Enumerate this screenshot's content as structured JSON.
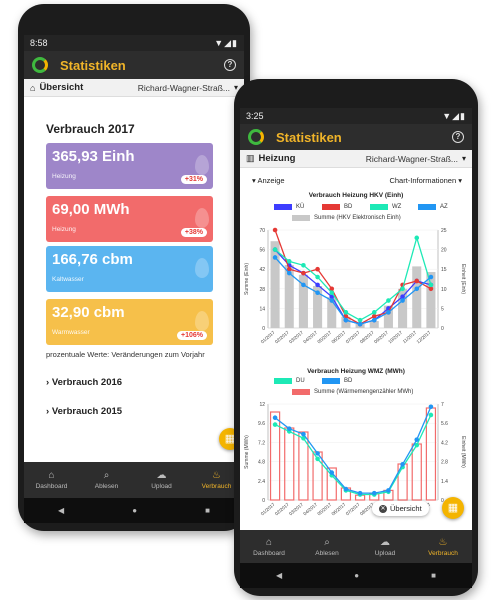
{
  "phone1": {
    "status": {
      "time": "8:58",
      "icons": "▼◢▮"
    },
    "app_title": "Statistiken",
    "sub": {
      "label": "Übersicht",
      "address": "Richard-Wagner-Straß..."
    },
    "heading": "Verbrauch 2017",
    "cards": [
      {
        "value": "365,93 Einh",
        "label": "Heizung",
        "badge": "+31%",
        "color": "#9e86c9"
      },
      {
        "value": "69,00 MWh",
        "label": "Heizung",
        "badge": "+38%",
        "color": "#f26b6b"
      },
      {
        "value": "166,76 cbm",
        "label": "Kaltwasser",
        "badge": "",
        "color": "#5bb5f0"
      },
      {
        "value": "32,90 cbm",
        "label": "Warmwasser",
        "badge": "+106%",
        "color": "#f6c04a"
      }
    ],
    "note": "prozentuale Werte: Veränderungen zum Vorjahr",
    "sections": [
      "Verbrauch 2016",
      "Verbrauch 2015"
    ],
    "nav": [
      {
        "label": "Dashboard",
        "icon": "⌂"
      },
      {
        "label": "Ablesen",
        "icon": "⌕"
      },
      {
        "label": "Upload",
        "icon": "☁"
      },
      {
        "label": "Verbrauch",
        "icon": "♨"
      }
    ]
  },
  "phone2": {
    "status": {
      "time": "3:25",
      "icons": "▼◢▮"
    },
    "app_title": "Statistiken",
    "sub": {
      "label": "Heizung",
      "address": "Richard-Wagner-Straß..."
    },
    "controls": {
      "left": "Anzeige",
      "right": "Chart-Informationen"
    },
    "chart1": {
      "title": "Verbrauch Heizung HKV (Einh)",
      "legend": [
        "KÜ",
        "BD",
        "WZ",
        "AZ"
      ],
      "legend_bar": "Summe (HKV Elektronisch Einh)",
      "ylabel_left": "Summe (Einh)",
      "ylabel_right": "Einheit (Einh)"
    },
    "chart2": {
      "title": "Verbrauch Heizung WMZ (MWh)",
      "legend": [
        "DU",
        "BD"
      ],
      "legend_bar": "Summe (Wärmemengenzähler MWh)",
      "ylabel_left": "Summe (MWh)",
      "ylabel_right": "Einheit (MWh)"
    },
    "tooltip": "Übersicht",
    "nav": [
      {
        "label": "Dashboard",
        "icon": "⌂"
      },
      {
        "label": "Ablesen",
        "icon": "⌕"
      },
      {
        "label": "Upload",
        "icon": "☁"
      },
      {
        "label": "Verbrauch",
        "icon": "♨"
      }
    ]
  },
  "chart_data": [
    {
      "type": "bar",
      "title": "Verbrauch Heizung HKV (Einh)",
      "categories": [
        "01/2017",
        "02/2017",
        "03/2017",
        "04/2017",
        "05/2017",
        "06/2017",
        "07/2017",
        "08/2017",
        "09/2017",
        "10/2017",
        "11/2017",
        "12/2017"
      ],
      "ylim": [
        0,
        70
      ],
      "y2lim": [
        0,
        25
      ],
      "bar": {
        "name": "Summe (HKV Elektronisch Einh)",
        "color": "#c8c8c8",
        "values": [
          62,
          45,
          38,
          30,
          22,
          8,
          3,
          5,
          16,
          28,
          44,
          40
        ]
      },
      "series": [
        {
          "name": "KÜ",
          "color": "#3d3dff",
          "values": [
            20,
            16,
            14,
            11,
            8,
            2,
            1,
            2,
            5,
            8,
            12,
            11
          ]
        },
        {
          "name": "BD",
          "color": "#e53935",
          "values": [
            25,
            15,
            14,
            15,
            10,
            3,
            1,
            3,
            4,
            11,
            12,
            10
          ]
        },
        {
          "name": "WZ",
          "color": "#1de9b6",
          "values": [
            20,
            17,
            16,
            13,
            9,
            4,
            2,
            4,
            7,
            10,
            23,
            11
          ]
        },
        {
          "name": "AZ",
          "color": "#2196f3",
          "values": [
            18,
            14,
            11,
            9,
            7,
            2,
            1,
            2,
            4,
            7,
            10,
            13
          ]
        }
      ]
    },
    {
      "type": "bar",
      "title": "Verbrauch Heizung WMZ (MWh)",
      "categories": [
        "01/2017",
        "02/2017",
        "03/2017",
        "04/2017",
        "05/2017",
        "06/2017",
        "07/2017",
        "08/2017",
        "09/2017",
        "10/2017",
        "11/2017",
        "12/2017"
      ],
      "ylim": [
        0,
        12
      ],
      "y2lim": [
        0,
        7
      ],
      "bar": {
        "name": "Summe (Wärmemengenzähler MWh)",
        "color": "#f26b6b",
        "values": [
          11,
          9,
          8.5,
          6,
          4,
          1.5,
          0.6,
          0.8,
          1.2,
          4.5,
          7,
          11.5
        ]
      },
      "series": [
        {
          "name": "DU",
          "color": "#1de9b6",
          "values": [
            5.5,
            5,
            4.5,
            3,
            1.8,
            0.7,
            0.4,
            0.4,
            0.6,
            2.4,
            4,
            6.2
          ]
        },
        {
          "name": "BD",
          "color": "#2196f3",
          "values": [
            6,
            5.2,
            4.8,
            3.4,
            2,
            0.8,
            0.5,
            0.5,
            0.7,
            2.6,
            4.4,
            6.8
          ]
        }
      ]
    }
  ]
}
